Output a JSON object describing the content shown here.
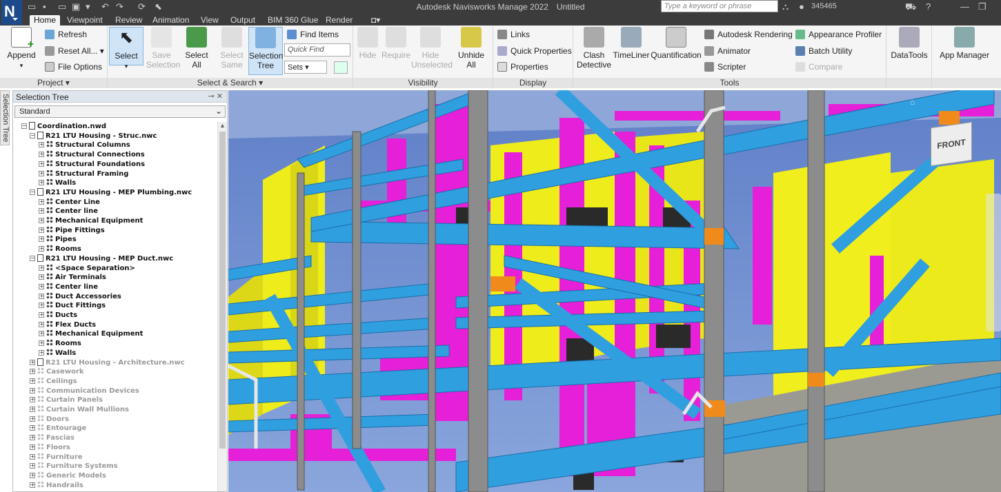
{
  "app": {
    "logo_letter": "N",
    "title": "Autodesk Navisworks Manage 2022",
    "document": "Untitled",
    "search_placeholder": "Type a keyword or phrase",
    "user_id": "345465"
  },
  "tabs": [
    "Home",
    "Viewpoint",
    "Review",
    "Animation",
    "View",
    "Output",
    "BIM 360 Glue",
    "Render"
  ],
  "ribbon": {
    "project": {
      "title": "Project",
      "append": "Append",
      "refresh": "Refresh",
      "reset_all": "Reset All...",
      "file_options": "File Options"
    },
    "select_search": {
      "title": "Select & Search",
      "select": "Select",
      "save_selection": "Save\nSelection",
      "select_all": "Select\nAll",
      "select_same": "Select\nSame",
      "selection_tree": "Selection\nTree",
      "find_items": "Find Items",
      "quick_find": "Quick Find",
      "sets": "Sets"
    },
    "visibility": {
      "title": "Visibility",
      "hide": "Hide",
      "require": "Require",
      "hide_unselected": "Hide\nUnselected",
      "unhide_all": "Unhide\nAll"
    },
    "display": {
      "title": "Display",
      "links": "Links",
      "quick_properties": "Quick Properties",
      "properties": "Properties"
    },
    "tools": {
      "title": "Tools",
      "clash_detective": "Clash\nDetective",
      "timeliner": "TimeLiner",
      "quantification": "Quantification",
      "autodesk_rendering": "Autodesk Rendering",
      "animator": "Animator",
      "scripter": "Scripter",
      "appearance_profiler": "Appearance Profiler",
      "batch_utility": "Batch Utility",
      "compare": "Compare",
      "datatools": "DataTools",
      "app_manager": "App Manager"
    }
  },
  "side_tab": "Selection Tree",
  "selection_tree": {
    "title": "Selection Tree",
    "mode": "Standard",
    "items": [
      {
        "label": "Coordination.nwd",
        "level": 0,
        "type": "file"
      },
      {
        "label": "R21 LTU Housing - Struc.nwc",
        "level": 1,
        "type": "file"
      },
      {
        "label": "Structural Columns",
        "level": 2,
        "type": "layer"
      },
      {
        "label": "Structural Connections",
        "level": 2,
        "type": "layer"
      },
      {
        "label": "Structural Foundations",
        "level": 2,
        "type": "layer"
      },
      {
        "label": "Structural Framing",
        "level": 2,
        "type": "layer"
      },
      {
        "label": "Walls",
        "level": 2,
        "type": "layer"
      },
      {
        "label": "R21 LTU Housing - MEP Plumbing.nwc",
        "level": 1,
        "type": "file"
      },
      {
        "label": "Center Line",
        "level": 2,
        "type": "layer"
      },
      {
        "label": "Center line",
        "level": 2,
        "type": "layer"
      },
      {
        "label": "Mechanical Equipment",
        "level": 2,
        "type": "layer"
      },
      {
        "label": "Pipe Fittings",
        "level": 2,
        "type": "layer"
      },
      {
        "label": "Pipes",
        "level": 2,
        "type": "layer"
      },
      {
        "label": "Rooms",
        "level": 2,
        "type": "layer"
      },
      {
        "label": "R21 LTU Housing - MEP Duct.nwc",
        "level": 1,
        "type": "file"
      },
      {
        "label": "<Space Separation>",
        "level": 2,
        "type": "layer"
      },
      {
        "label": "Air Terminals",
        "level": 2,
        "type": "layer"
      },
      {
        "label": "Center line",
        "level": 2,
        "type": "layer"
      },
      {
        "label": "Duct Accessories",
        "level": 2,
        "type": "layer"
      },
      {
        "label": "Duct Fittings",
        "level": 2,
        "type": "layer"
      },
      {
        "label": "Ducts",
        "level": 2,
        "type": "layer"
      },
      {
        "label": "Flex Ducts",
        "level": 2,
        "type": "layer"
      },
      {
        "label": "Mechanical Equipment",
        "level": 2,
        "type": "layer"
      },
      {
        "label": "Rooms",
        "level": 2,
        "type": "layer"
      },
      {
        "label": "Walls",
        "level": 2,
        "type": "layer"
      },
      {
        "label": "R21 LTU Housing - Architecture.nwc",
        "level": 1,
        "type": "file",
        "hidden": true
      },
      {
        "label": "Casework",
        "level": 1,
        "type": "layer",
        "hidden": true
      },
      {
        "label": "Ceilings",
        "level": 1,
        "type": "layer",
        "hidden": true
      },
      {
        "label": "Communication Devices",
        "level": 1,
        "type": "layer",
        "hidden": true
      },
      {
        "label": "Curtain Panels",
        "level": 1,
        "type": "layer",
        "hidden": true
      },
      {
        "label": "Curtain Wall Mullions",
        "level": 1,
        "type": "layer",
        "hidden": true
      },
      {
        "label": "Doors",
        "level": 1,
        "type": "layer",
        "hidden": true
      },
      {
        "label": "Entourage",
        "level": 1,
        "type": "layer",
        "hidden": true
      },
      {
        "label": "Fascias",
        "level": 1,
        "type": "layer",
        "hidden": true
      },
      {
        "label": "Floors",
        "level": 1,
        "type": "layer",
        "hidden": true
      },
      {
        "label": "Furniture",
        "level": 1,
        "type": "layer",
        "hidden": true
      },
      {
        "label": "Furniture Systems",
        "level": 1,
        "type": "layer",
        "hidden": true
      },
      {
        "label": "Generic Models",
        "level": 1,
        "type": "layer",
        "hidden": true
      },
      {
        "label": "Handrails",
        "level": 1,
        "type": "layer",
        "hidden": true
      }
    ]
  },
  "viewport": {
    "viewcube_label": "FRONT"
  },
  "colors": {
    "structure_blue": "#2f9fe0",
    "duct_magenta": "#e61fd8",
    "wall_yellow": "#f4f21a",
    "column_grey": "#8c8c8c",
    "sky": "#6f8fcf"
  }
}
